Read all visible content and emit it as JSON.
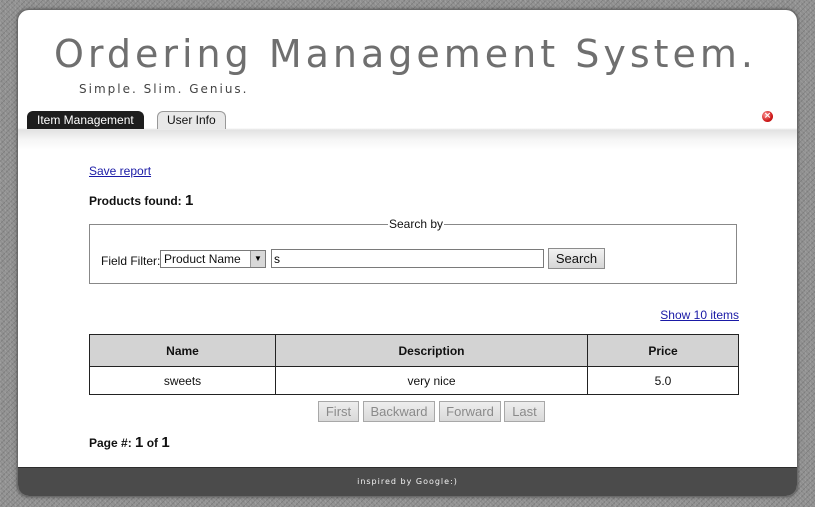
{
  "header": {
    "title": "Ordering Management System.",
    "tagline": "Simple. Slim. Genius."
  },
  "tabs": [
    {
      "label": "Item Management",
      "active": true
    },
    {
      "label": "User Info",
      "active": false
    }
  ],
  "close_icon": "close-icon",
  "report": {
    "save_label": "Save report"
  },
  "products_found": {
    "label": "Products found:",
    "count": "1"
  },
  "search": {
    "legend": "Search by",
    "field_filter_label": "Field Filter:",
    "selected_field": "Product Name",
    "query_value": "s",
    "button_label": "Search"
  },
  "show_items_label": "Show 10 items",
  "table": {
    "columns": [
      "Name",
      "Description",
      "Price"
    ],
    "rows": [
      [
        "sweets",
        "very nice",
        "5.0"
      ]
    ]
  },
  "pager": {
    "first": "First",
    "backward": "Backward",
    "forward": "Forward",
    "last": "Last"
  },
  "page_info": {
    "label": "Page #:",
    "current": "1",
    "of": "of",
    "total": "1"
  },
  "footer": {
    "text": "inspired by Google:)"
  },
  "colors": {
    "active_tab": "#1e1e1e",
    "footer": "#4b4b4b",
    "table_header": "#d3d3d3",
    "link": "#1a1aa6"
  }
}
